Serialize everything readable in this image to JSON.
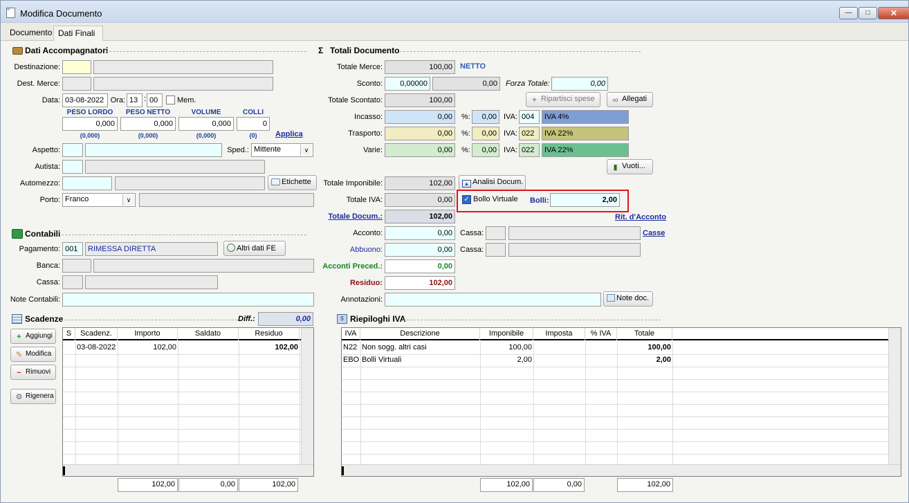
{
  "window": {
    "title": "Modifica Documento"
  },
  "tabs": [
    {
      "label": "Documento"
    },
    {
      "label": "Dati Finali"
    }
  ],
  "accompagnatori": {
    "title": "Dati Accompagnatori",
    "destinazione_label": "Destinazione:",
    "dest_merce_label": "Dest. Merce:",
    "data_label": "Data:",
    "data_value": "03-08-2022",
    "ora_label": "Ora:",
    "ora_h": "13",
    "ora_m": "00",
    "mem_label": "Mem.",
    "peso_lordo_label": "PESO LORDO",
    "peso_netto_label": "PESO NETTO",
    "volume_label": "VOLUME",
    "colli_label": "COLLI",
    "peso_lordo": "0,000",
    "peso_netto": "0,000",
    "volume": "0,000",
    "colli": "0",
    "peso_lordo_sub": "(0,000)",
    "peso_netto_sub": "(0,000)",
    "volume_sub": "(0,000)",
    "colli_sub": "(0)",
    "applica_label": "Applica",
    "aspetto_label": "Aspetto:",
    "sped_label": "Sped.:",
    "sped_value": "Mittente",
    "autista_label": "Autista:",
    "automezzo_label": "Automezzo:",
    "etichette_label": "Etichette",
    "porto_label": "Porto:",
    "porto_value": "Franco"
  },
  "contabili": {
    "title": "Contabili",
    "pagamento_label": "Pagamento:",
    "pagamento_code": "001",
    "pagamento_desc": "RIMESSA DIRETTA",
    "altri_dati_label": "Altri dati FE",
    "banca_label": "Banca:",
    "cassa_label": "Cassa:",
    "note_label": "Note Contabili:"
  },
  "totali": {
    "title": "Totali Documento",
    "totale_merce_label": "Totale Merce:",
    "totale_merce": "100,00",
    "netto_label": "NETTO",
    "sconto_label": "Sconto:",
    "sconto_pct": "0,00000",
    "sconto_val": "0,00",
    "forza_totale_label": "Forza Totale:",
    "forza_totale": "0,00",
    "totale_scontato_label": "Totale Scontato:",
    "totale_scontato": "100,00",
    "ripartisci_label": "Ripartisci spese",
    "allegati_label": "Allegati",
    "incasso_label": "Incasso:",
    "incasso": "0,00",
    "trasporto_label": "Trasporto:",
    "trasporto": "0,00",
    "varie_label": "Varie:",
    "varie": "0,00",
    "pct_label": "%:",
    "iva_label": "IVA:",
    "incasso_pct": "0,00",
    "trasporto_pct": "0,00",
    "varie_pct": "0,00",
    "incasso_iva_code": "004",
    "incasso_iva_desc": "IVA  4%",
    "trasporto_iva_code": "022",
    "trasporto_iva_desc": "IVA 22%",
    "varie_iva_code": "022",
    "varie_iva_desc": "IVA 22%",
    "vuoti_label": "Vuoti...",
    "totale_imponibile_label": "Totale Imponibile:",
    "totale_imponibile": "102,00",
    "analisi_label": "Analisi Docum.",
    "totale_iva_label": "Totale IVA:",
    "totale_iva": "0,00",
    "bollo_virtuale_label": "Bollo Virtuale",
    "bolli_label": "Bolli:",
    "bolli": "2,00",
    "totale_docum_label": "Totale Docum.:",
    "totale_docum": "102,00",
    "rit_acconto_label": "Rit. d'Acconto",
    "acconto_label": "Acconto:",
    "acconto": "0,00",
    "cassa_label": "Cassa:",
    "casse_label": "Casse",
    "abbuono_label": "Abbuono:",
    "abbuono": "0,00",
    "acconti_preced_label": "Acconti Preced.:",
    "acconti_preced": "0,00",
    "residuo_label": "Residuo:",
    "residuo": "102,00",
    "annotazioni_label": "Annotazioni:",
    "note_doc_label": "Note doc."
  },
  "scadenze": {
    "title": "Scadenze",
    "diff_label": "Diff.:",
    "diff": "0,00",
    "aggiungi_label": "Aggiungi",
    "modifica_label": "Modifica",
    "rimuovi_label": "Rimuovi",
    "rigenera_label": "Rigenera",
    "columns": [
      "S",
      "Scadenz.",
      "Importo",
      "Saldato",
      "Residuo"
    ],
    "rows": [
      {
        "s": "",
        "scadenza": "03-08-2022",
        "importo": "102,00",
        "saldato": "",
        "residuo": "102,00"
      }
    ],
    "tot_importo": "102,00",
    "tot_saldato": "0,00",
    "tot_residuo": "102,00"
  },
  "riepiloghi": {
    "title": "Riepiloghi IVA",
    "columns": [
      "IVA",
      "Descrizione",
      "Imponibile",
      "Imposta",
      "% IVA",
      "Totale"
    ],
    "rows": [
      {
        "iva": "N22",
        "descrizione": "Non sogg. altri casi",
        "imponibile": "100,00",
        "imposta": "",
        "pct": "",
        "totale": "100,00"
      },
      {
        "iva": "EBO",
        "descrizione": "Bolli Virtuali",
        "imponibile": "2,00",
        "imposta": "",
        "pct": "",
        "totale": "2,00"
      }
    ],
    "tot_imponibile": "102,00",
    "tot_imposta": "0,00",
    "tot_totale": "102,00"
  },
  "colors": {
    "highlight": "#e0161b",
    "link": "#1d2c9f",
    "green": "#0f8a1f",
    "darkred": "#8b1010"
  }
}
